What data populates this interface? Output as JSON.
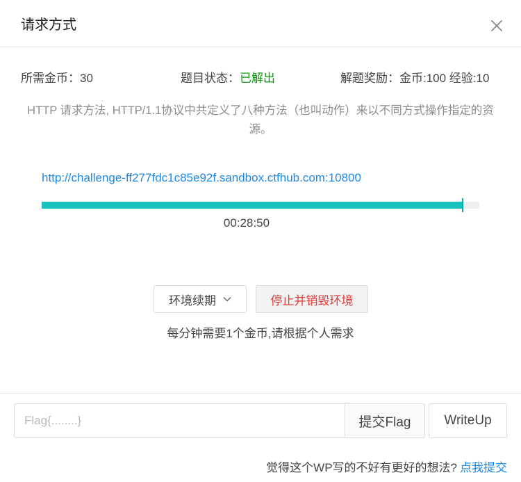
{
  "dialog": {
    "title": "请求方式",
    "close_icon": "close-icon"
  },
  "stats": {
    "coins_label": "所需金币：",
    "coins_value": "30",
    "status_label": "题目状态：",
    "status_value": "已解出",
    "status_color": "#119911",
    "reward_label": "解题奖励：",
    "reward_value": "金币:100 经验:10"
  },
  "description": "HTTP 请求方法, HTTP/1.1协议中共定义了八种方法（也叫动作）来以不同方式操作指定的资源。",
  "environment": {
    "url": "http://challenge-ff277fdc1c85e92f.sandbox.ctfhub.com:10800",
    "remaining_fraction": 0.962,
    "timer": "00:28:50",
    "bar_color": "#17c1be"
  },
  "actions": {
    "renew_label": "环境续期",
    "stop_label": "停止并销毁环境",
    "stop_color": "#e23b3b",
    "note": "每分钟需要1个金币,请根据个人需求"
  },
  "flag": {
    "placeholder": "Flag{........}",
    "value": "",
    "submit_label": "提交Flag",
    "writeup_label": "WriteUp"
  },
  "footer": {
    "prompt": "觉得这个WP写的不好有更好的想法?",
    "link": "点我提交",
    "link_color": "#1e88e5"
  }
}
